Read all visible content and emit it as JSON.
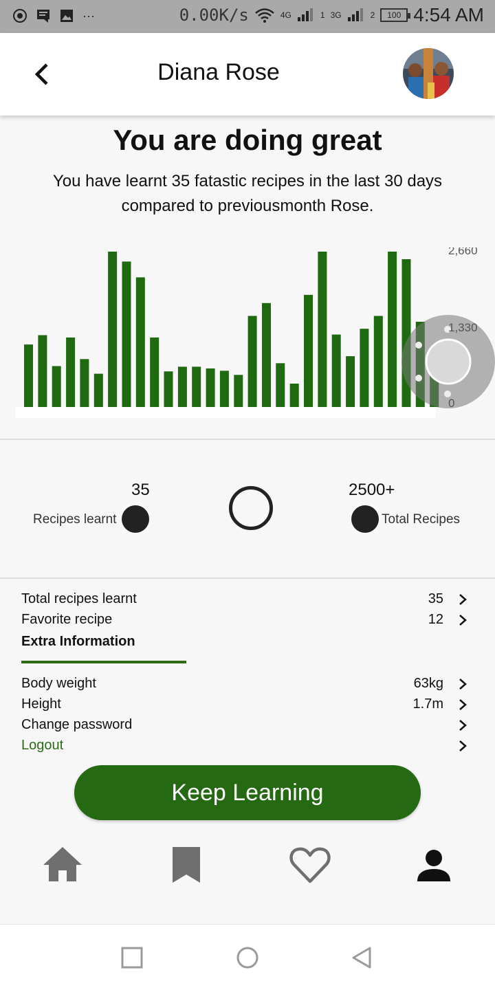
{
  "status_bar": {
    "net_speed": "0.00K/s",
    "sig_4g": "4G",
    "sig_3g": "3G",
    "sim1": "1",
    "sim2": "2",
    "battery": "100",
    "time": "4:54 AM",
    "overflow": "···"
  },
  "header": {
    "title": "Diana Rose"
  },
  "summary": {
    "headline": "You are doing great",
    "message": "You have learnt 35 fatastic recipes in the last 30 days compared to previousmonth Rose."
  },
  "stats": {
    "learnt_value": "35",
    "learnt_label": "Recipes learnt",
    "total_value": "2500+",
    "total_label": "Total Recipes"
  },
  "details": {
    "total_learnt_label": "Total recipes learnt",
    "total_learnt_value": "35",
    "favorite_label": "Favorite recipe",
    "favorite_value": "12",
    "extra_title": "Extra Information",
    "body_weight_label": "Body weight",
    "body_weight_value": "63kg",
    "height_label": "Height",
    "height_value": "1.7m",
    "change_password_label": "Change password",
    "logout_label": "Logout"
  },
  "cta_label": "Keep Learning",
  "bottom_nav": [
    "home-icon",
    "bookmark-icon",
    "heart-icon",
    "person-icon"
  ],
  "colors": {
    "accent": "#256912",
    "bar": "#1f6a10",
    "status_bar": "#a9a9a9"
  },
  "chart_data": {
    "type": "bar",
    "y_ticks": [
      "2,660",
      "1,330",
      "0"
    ],
    "ylim": [
      0,
      2660
    ],
    "values": [
      1070,
      1230,
      700,
      1190,
      820,
      570,
      2660,
      2490,
      2220,
      1190,
      610,
      690,
      690,
      660,
      620,
      550,
      1560,
      1780,
      750,
      400,
      1920,
      2660,
      1240,
      870,
      1340,
      1560,
      2660,
      2530,
      1460,
      880
    ]
  }
}
